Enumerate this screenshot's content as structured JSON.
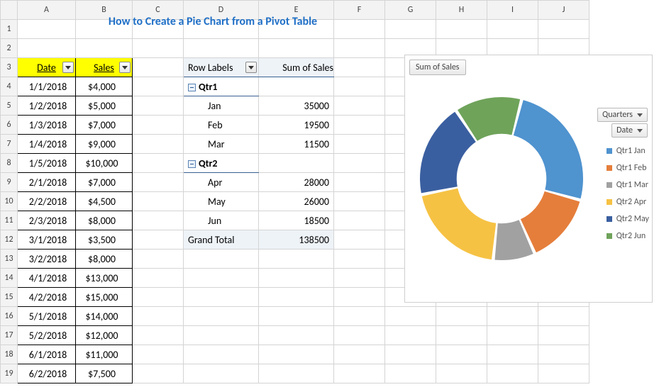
{
  "title": "How to Create a Pie Chart from a Pivot Table",
  "columns": [
    "A",
    "B",
    "C",
    "D",
    "E",
    "F",
    "G",
    "H",
    "I",
    "J"
  ],
  "row_numbers": [
    1,
    2,
    3,
    4,
    5,
    6,
    7,
    8,
    9,
    10,
    11,
    12,
    13,
    14,
    15,
    16,
    17,
    18,
    19
  ],
  "data_table": {
    "headers": {
      "date": "Date",
      "sales": "Sales"
    },
    "rows": [
      {
        "date": "1/1/2018",
        "sales": "$4,000"
      },
      {
        "date": "1/2/2018",
        "sales": "$5,000"
      },
      {
        "date": "1/3/2018",
        "sales": "$7,000"
      },
      {
        "date": "1/4/2018",
        "sales": "$9,000"
      },
      {
        "date": "1/5/2018",
        "sales": "$10,000"
      },
      {
        "date": "2/1/2018",
        "sales": "$7,000"
      },
      {
        "date": "2/2/2018",
        "sales": "$4,500"
      },
      {
        "date": "2/3/2018",
        "sales": "$8,000"
      },
      {
        "date": "3/1/2018",
        "sales": "$3,500"
      },
      {
        "date": "3/2/2018",
        "sales": "$8,000"
      },
      {
        "date": "4/1/2018",
        "sales": "$13,000"
      },
      {
        "date": "4/2/2018",
        "sales": "$15,000"
      },
      {
        "date": "5/1/2018",
        "sales": "$14,000"
      },
      {
        "date": "5/2/2018",
        "sales": "$12,000"
      },
      {
        "date": "6/1/2018",
        "sales": "$11,000"
      },
      {
        "date": "6/2/2018",
        "sales": "$7,500"
      }
    ]
  },
  "pivot": {
    "row_labels": "Row Labels",
    "sum_head": "Sum of Sales",
    "groups": [
      {
        "name": "Qtr1",
        "items": [
          {
            "label": "Jan",
            "value": "35000"
          },
          {
            "label": "Feb",
            "value": "19500"
          },
          {
            "label": "Mar",
            "value": "11500"
          }
        ]
      },
      {
        "name": "Qtr2",
        "items": [
          {
            "label": "Apr",
            "value": "28000"
          },
          {
            "label": "May",
            "value": "26000"
          },
          {
            "label": "Jun",
            "value": "18500"
          }
        ]
      }
    ],
    "grand_label": "Grand Total",
    "grand_value": "138500"
  },
  "chart": {
    "title": "Sum of Sales",
    "slicers": {
      "quarters": "Quarters",
      "date": "Date"
    },
    "legend": [
      {
        "color": "#4f93cf",
        "label": "Qtr1 Jan"
      },
      {
        "color": "#e57e3b",
        "label": "Qtr1 Feb"
      },
      {
        "color": "#a1a1a1",
        "label": "Qtr1 Mar"
      },
      {
        "color": "#f6c244",
        "label": "Qtr2 Apr"
      },
      {
        "color": "#3a5fa0",
        "label": "Qtr2 May"
      },
      {
        "color": "#6fa35a",
        "label": "Qtr2 Jun"
      }
    ]
  },
  "chart_data": {
    "type": "pie",
    "title": "Sum of Sales",
    "series": [
      {
        "name": "Qtr1 Jan",
        "value": 35000,
        "color": "#4f93cf"
      },
      {
        "name": "Qtr1 Feb",
        "value": 19500,
        "color": "#e57e3b"
      },
      {
        "name": "Qtr1 Mar",
        "value": 11500,
        "color": "#a1a1a1"
      },
      {
        "name": "Qtr2 Apr",
        "value": 28000,
        "color": "#f6c244"
      },
      {
        "name": "Qtr2 May",
        "value": 26000,
        "color": "#3a5fa0"
      },
      {
        "name": "Qtr2 Jun",
        "value": 18500,
        "color": "#6fa35a"
      }
    ],
    "total": 138500,
    "inner_radius_ratio": 0.55
  }
}
